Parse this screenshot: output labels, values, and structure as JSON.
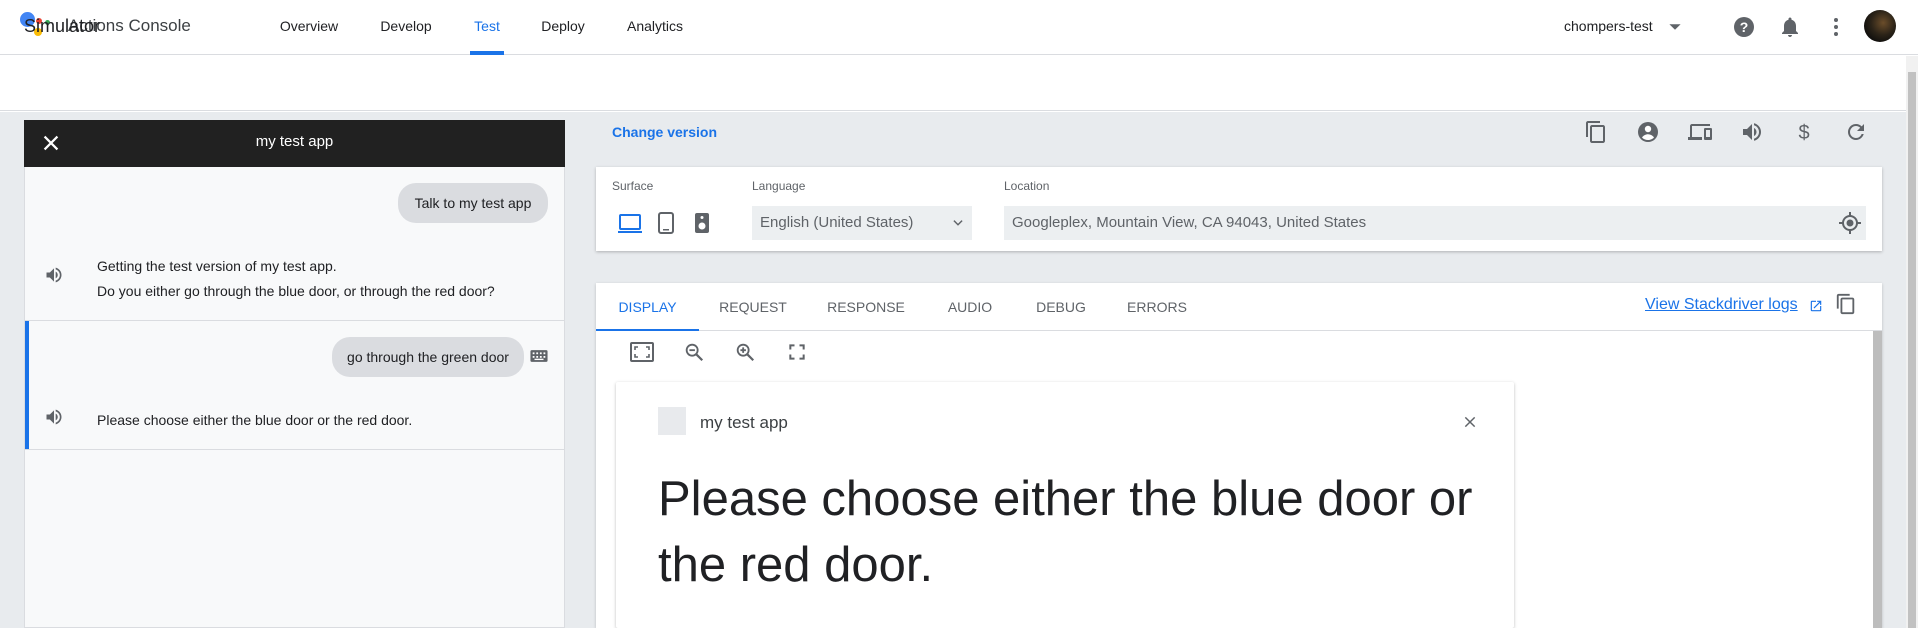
{
  "app": {
    "title": "Actions Console"
  },
  "nav": {
    "items": [
      {
        "label": "Overview",
        "active": false
      },
      {
        "label": "Develop",
        "active": false
      },
      {
        "label": "Test",
        "active": true
      },
      {
        "label": "Deploy",
        "active": false
      },
      {
        "label": "Analytics",
        "active": false
      }
    ]
  },
  "header": {
    "project": "chompers-test",
    "icons": [
      "help-icon",
      "notifications-icon",
      "more-vert-icon",
      "avatar"
    ]
  },
  "simulator": {
    "title": "Simulator"
  },
  "chat": {
    "app_name": "my test app",
    "messages": [
      {
        "from": "user",
        "text": "Talk to my test app"
      },
      {
        "from": "bot",
        "lines": [
          "Getting the test version of my test app.",
          "Do you either go through the blue door, or through the red door?"
        ]
      },
      {
        "from": "user",
        "text": "go through the green door",
        "input": "keyboard"
      },
      {
        "from": "bot",
        "lines": [
          "Please choose either the blue door or the red door."
        ]
      }
    ]
  },
  "controls": {
    "change_version": "Change version",
    "toolbar_icons": [
      "file-copy-icon",
      "account-circle-icon",
      "devices-icon",
      "volume-icon",
      "dollar-icon",
      "refresh-icon"
    ],
    "surface_label": "Surface",
    "language_label": "Language",
    "language_value": "English (United States)",
    "location_label": "Location",
    "location_value": "Googleplex, Mountain View, CA 94043, United States"
  },
  "tabs": {
    "items": [
      {
        "label": "DISPLAY",
        "active": true
      },
      {
        "label": "REQUEST",
        "active": false
      },
      {
        "label": "RESPONSE",
        "active": false
      },
      {
        "label": "AUDIO",
        "active": false
      },
      {
        "label": "DEBUG",
        "active": false
      },
      {
        "label": "ERRORS",
        "active": false
      }
    ],
    "stackdriver": "View Stackdriver logs"
  },
  "display": {
    "card_title": "my test app",
    "card_text": "Please choose either the blue door or the red door."
  },
  "colors": {
    "accent": "#1a73e8",
    "header_dark": "#212121",
    "bubble": "#dadce0"
  }
}
